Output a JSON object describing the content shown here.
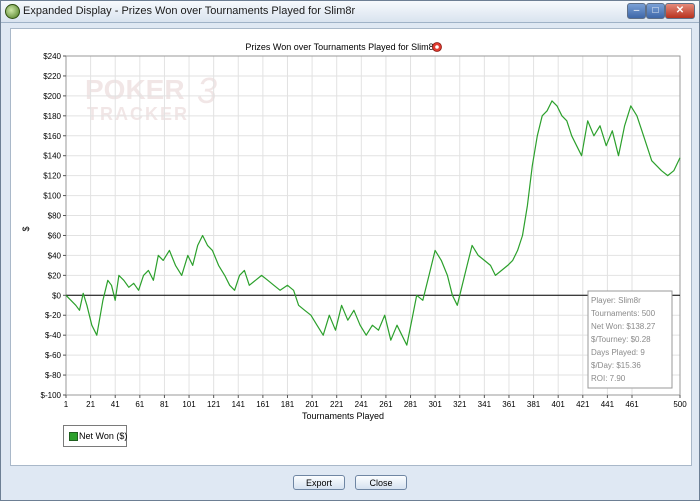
{
  "window": {
    "title": "Expanded Display - Prizes Won over Tournaments Played for Slim8r",
    "minimize_glyph": "–",
    "maximize_glyph": "□",
    "close_glyph": "✕"
  },
  "watermark": {
    "line1": "POKER",
    "line1b": "3",
    "line2": "TRACKER"
  },
  "buttons": {
    "export_label": "Export",
    "close_label": "Close"
  },
  "colors": {
    "series": "#2ca02c",
    "grid": "#e2e2e2",
    "zero_line": "#000000",
    "window_bg": "#dfe8f3",
    "stats_text": "#8a8a8a"
  },
  "icons": {
    "title_icon": "poker-chip-icon",
    "app_icon": "app-icon"
  },
  "stats": {
    "player": "Player: Slim8r",
    "tournaments": "Tournaments: 500",
    "net_won": "Net Won: $138.27",
    "per_tourney": "$/Tourney: $0.28",
    "days_played": "Days Played: 9",
    "per_day": "$/Day: $15.36",
    "roi": "ROI: 7.90"
  },
  "chart_data": {
    "type": "line",
    "title": "Prizes Won over Tournaments Played for Slim8r",
    "xlabel": "Tournaments Played",
    "ylabel": "$",
    "xlim": [
      1,
      500
    ],
    "ylim": [
      -100,
      240
    ],
    "x_ticks": [
      1,
      21,
      41,
      61,
      81,
      101,
      121,
      141,
      161,
      181,
      201,
      221,
      241,
      261,
      281,
      301,
      321,
      341,
      361,
      381,
      401,
      421,
      441,
      461,
      500
    ],
    "y_ticks": [
      240,
      220,
      200,
      180,
      160,
      140,
      120,
      100,
      80,
      60,
      40,
      20,
      0,
      -20,
      -40,
      -60,
      -80,
      -100
    ],
    "y_tick_labels": [
      "$240",
      "$220",
      "$200",
      "$180",
      "$160",
      "$140",
      "$120",
      "$100",
      "$80",
      "$60",
      "$40",
      "$20",
      "$0",
      "$-20",
      "$-40",
      "$-60",
      "$-80",
      "$-100"
    ],
    "grid": true,
    "legend_position": "bottom-left",
    "series": [
      {
        "name": "Net Won ($)",
        "x": [
          1,
          5,
          9,
          12,
          15,
          18,
          22,
          26,
          31,
          35,
          38,
          41,
          44,
          48,
          52,
          56,
          60,
          64,
          68,
          72,
          76,
          80,
          85,
          90,
          95,
          100,
          104,
          108,
          112,
          116,
          120,
          125,
          130,
          134,
          138,
          142,
          146,
          150,
          155,
          160,
          165,
          170,
          175,
          181,
          186,
          190,
          195,
          200,
          205,
          210,
          215,
          220,
          225,
          230,
          235,
          240,
          245,
          250,
          255,
          260,
          265,
          270,
          274,
          278,
          282,
          286,
          291,
          296,
          301,
          306,
          311,
          315,
          319,
          323,
          327,
          331,
          336,
          341,
          346,
          350,
          355,
          360,
          364,
          368,
          372,
          376,
          380,
          384,
          388,
          392,
          396,
          400,
          404,
          408,
          412,
          416,
          420,
          425,
          430,
          435,
          440,
          445,
          450,
          455,
          460,
          465,
          469,
          473,
          477,
          481,
          485,
          490,
          495,
          500
        ],
        "y": [
          0,
          -5,
          -10,
          -15,
          2,
          -10,
          -30,
          -40,
          -5,
          15,
          10,
          -5,
          20,
          15,
          8,
          12,
          5,
          20,
          25,
          15,
          40,
          35,
          45,
          30,
          20,
          40,
          30,
          50,
          60,
          50,
          45,
          30,
          20,
          10,
          5,
          20,
          25,
          10,
          15,
          20,
          15,
          10,
          5,
          10,
          5,
          -10,
          -15,
          -20,
          -30,
          -40,
          -20,
          -35,
          -10,
          -25,
          -15,
          -30,
          -40,
          -30,
          -35,
          -20,
          -45,
          -30,
          -40,
          -50,
          -25,
          0,
          -5,
          20,
          45,
          35,
          20,
          0,
          -10,
          10,
          30,
          50,
          40,
          35,
          30,
          20,
          25,
          30,
          35,
          45,
          60,
          90,
          130,
          160,
          180,
          185,
          195,
          190,
          180,
          175,
          160,
          150,
          140,
          175,
          160,
          170,
          150,
          165,
          140,
          170,
          190,
          180,
          165,
          150,
          135,
          130,
          125,
          120,
          125,
          138
        ]
      }
    ]
  }
}
